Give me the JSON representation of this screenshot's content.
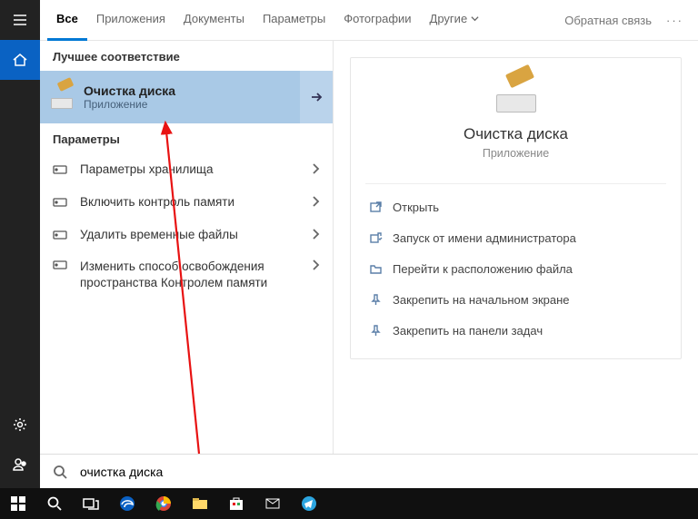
{
  "tabs": {
    "all": "Все",
    "apps": "Приложения",
    "docs": "Документы",
    "settings": "Параметры",
    "photos": "Фотографии",
    "other": "Другие",
    "feedback": "Обратная связь"
  },
  "sections": {
    "bestmatch": "Лучшее соответствие",
    "settings": "Параметры"
  },
  "bestmatch": {
    "title": "Очистка диска",
    "subtitle": "Приложение"
  },
  "params": [
    {
      "label": "Параметры хранилища"
    },
    {
      "label": "Включить контроль памяти"
    },
    {
      "label": "Удалить временные файлы"
    },
    {
      "label": "Изменить способ освобождения пространства Контролем памяти"
    }
  ],
  "detail": {
    "title": "Очистка диска",
    "subtitle": "Приложение",
    "actions": {
      "open": "Открыть",
      "admin": "Запуск от имени администратора",
      "location": "Перейти к расположению файла",
      "pin_start": "Закрепить на начальном экране",
      "pin_task": "Закрепить на панели задач"
    }
  },
  "search": {
    "value": "очистка диска"
  }
}
